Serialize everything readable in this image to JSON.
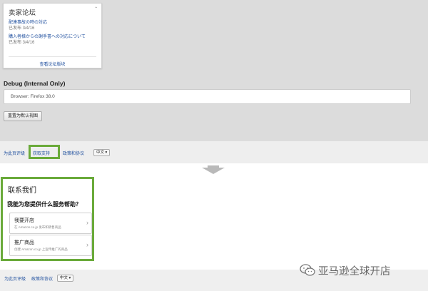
{
  "top": {
    "forum": {
      "title": "卖家论坛",
      "caret": "ˆ",
      "items": [
        {
          "link": "配達事故の時の対応",
          "meta": "已发布 3/4/16"
        },
        {
          "link": "購入者様からの謝手書への対応について",
          "meta": "已发布 3/4/16"
        }
      ],
      "view_all": "查看论坛版块"
    },
    "debug": {
      "title": "Debug (Internal Only)",
      "browser": "Browser: Firefox 38.0"
    },
    "reset_button": "重置为默认视图",
    "footer": {
      "rate": "为此页评级",
      "support": "获取支持",
      "policy": "政策和协议",
      "language": "中文 ▾"
    }
  },
  "bottom": {
    "contact": {
      "title": "联系我们",
      "question": "我能为您提供什么服务帮助？",
      "options": [
        {
          "title": "我要开店",
          "subtitle": "在 Amazon.co.jp 发布和销售商品",
          "chevron": "›"
        },
        {
          "title": "推广商品",
          "subtitle": "创建 Amazon.co.jp 上宣传推广的商品",
          "chevron": "›"
        }
      ]
    },
    "footer": {
      "rate": "为此页评级",
      "policy": "政策和协议",
      "language": "中文 ▾"
    }
  },
  "watermark": {
    "text": "亚马逊全球开店"
  },
  "colors": {
    "highlight": "#6aaa3a",
    "link": "#1f4f9e",
    "arrow": "#b9b9b9"
  }
}
